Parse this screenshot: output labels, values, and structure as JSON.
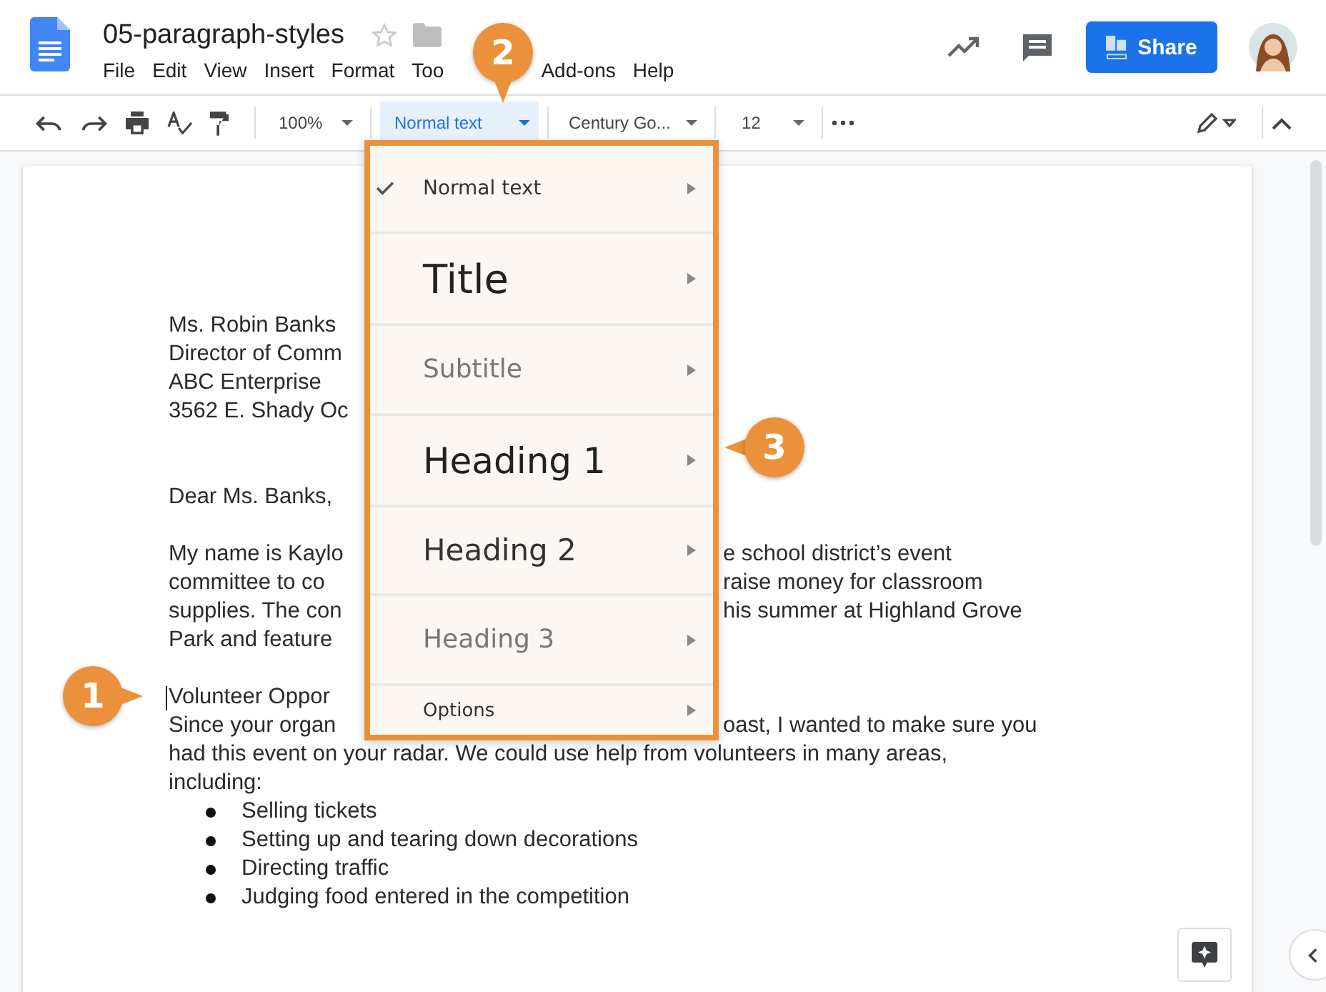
{
  "document": {
    "title": "05-paragraph-styles"
  },
  "menu_bar": [
    "File",
    "Edit",
    "View",
    "Insert",
    "Format",
    "Too",
    "Add-ons",
    "Help"
  ],
  "share_button": "Share",
  "toolbar": {
    "zoom": "100%",
    "style": "Normal text",
    "font": "Century Go...",
    "size": "12"
  },
  "style_menu": [
    {
      "label": "Normal text",
      "kind": "normal",
      "checked": true
    },
    {
      "label": "Title",
      "kind": "title",
      "checked": false
    },
    {
      "label": "Subtitle",
      "kind": "subtitle",
      "checked": false
    },
    {
      "label": "Heading 1",
      "kind": "heading1",
      "checked": false
    },
    {
      "label": "Heading 2",
      "kind": "heading2",
      "checked": false
    },
    {
      "label": "Heading 3",
      "kind": "heading3",
      "checked": false
    },
    {
      "label": "Options",
      "kind": "options",
      "checked": false
    }
  ],
  "letter": [
    {
      "kind": "paragraph",
      "lines": [
        {
          "left": "Ms. Robin Banks",
          "cursor": false
        },
        {
          "left": "Director of Comm",
          "cursor": false
        },
        {
          "left": "ABC Enterprise",
          "cursor": false
        },
        {
          "left": "3562 E. Shady Oc",
          "cursor": false
        }
      ]
    },
    {
      "kind": "paragraph",
      "lines": [
        {
          "left": "Dear Ms. Banks,",
          "cursor": false
        }
      ]
    },
    {
      "kind": "paragraph",
      "lines": [
        {
          "left": "My name is Kaylo",
          "right": "e school district’s event",
          "cursor": false
        },
        {
          "left": "committee to co",
          "right": "raise money for classroom",
          "cursor": false
        },
        {
          "left": "supplies. The con",
          "right": "his summer at Highland Grove",
          "cursor": false
        },
        {
          "left": "Park and feature",
          "cursor": false
        }
      ]
    },
    {
      "kind": "paragraph",
      "lines": [
        {
          "left": "Volunteer Oppor",
          "cursor": true
        },
        {
          "left": "Since your organ",
          "right": "oast, I wanted to make sure you",
          "cursor": false
        },
        {
          "left": "had this event on your radar. We could use help from volunteers in many areas,",
          "cursor": false
        },
        {
          "left": "including:",
          "cursor": false
        }
      ]
    },
    {
      "kind": "bullets",
      "lines": [
        {
          "left": "Selling tickets",
          "cursor": false
        },
        {
          "left": "Setting up and tearing down decorations",
          "cursor": false
        },
        {
          "left": "Directing traffic",
          "cursor": false
        },
        {
          "left": "Judging food entered in the competition",
          "cursor": false
        }
      ]
    }
  ],
  "callouts": [
    {
      "number": "1",
      "kind": "right"
    },
    {
      "number": "2",
      "kind": "down"
    },
    {
      "number": "3",
      "kind": "left"
    }
  ]
}
